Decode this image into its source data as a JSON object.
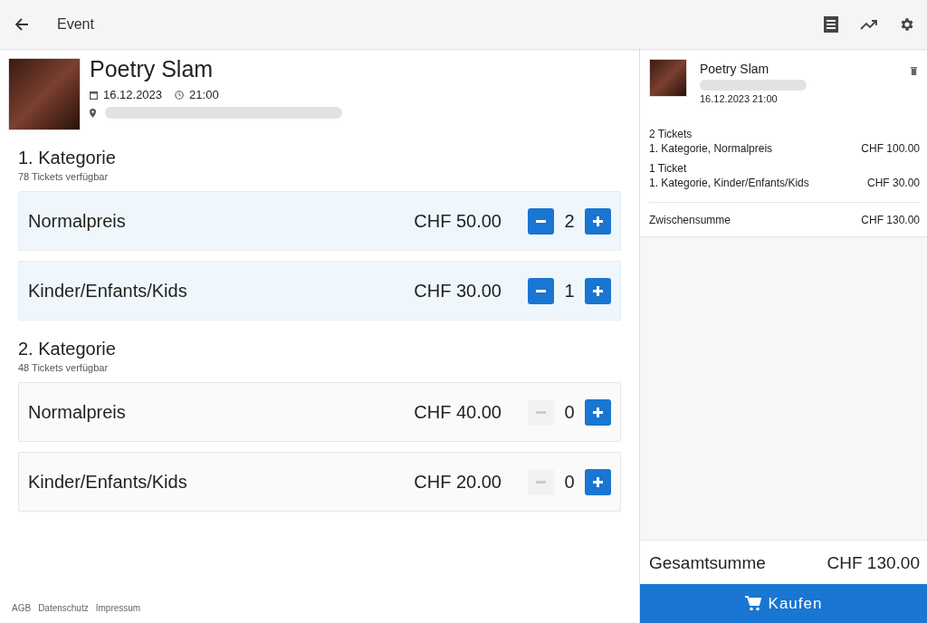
{
  "header": {
    "title": "Event"
  },
  "event": {
    "title": "Poetry Slam",
    "date": "16.12.2023",
    "time": "21:00"
  },
  "categories": [
    {
      "name": "1. Kategorie",
      "available": "78 Tickets verfügbar",
      "tickets": [
        {
          "name": "Normalpreis",
          "price": "CHF 50.00",
          "quantity": "2",
          "selected": true,
          "minus_disabled": false
        },
        {
          "name": "Kinder/Enfants/Kids",
          "price": "CHF 30.00",
          "quantity": "1",
          "selected": true,
          "minus_disabled": false
        }
      ]
    },
    {
      "name": "2. Kategorie",
      "available": "48 Tickets verfügbar",
      "tickets": [
        {
          "name": "Normalpreis",
          "price": "CHF 40.00",
          "quantity": "0",
          "selected": false,
          "minus_disabled": true
        },
        {
          "name": "Kinder/Enfants/Kids",
          "price": "CHF 20.00",
          "quantity": "0",
          "selected": false,
          "minus_disabled": true
        }
      ]
    }
  ],
  "footer_links": [
    "AGB",
    "Datenschutz",
    "Impressum"
  ],
  "cart": {
    "event_title": "Poetry Slam",
    "event_datetime": "16.12.2023 21:00",
    "lines": [
      {
        "count": "2 Tickets",
        "description": "1. Kategorie, Normalpreis",
        "price": "CHF 100.00"
      },
      {
        "count": "1 Ticket",
        "description": "1. Kategorie, Kinder/Enfants/Kids",
        "price": "CHF 30.00"
      }
    ],
    "subtotal_label": "Zwischensumme",
    "subtotal": "CHF 130.00",
    "total_label": "Gesamtsumme",
    "total": "CHF 130.00",
    "buy_button": "Kaufen"
  }
}
